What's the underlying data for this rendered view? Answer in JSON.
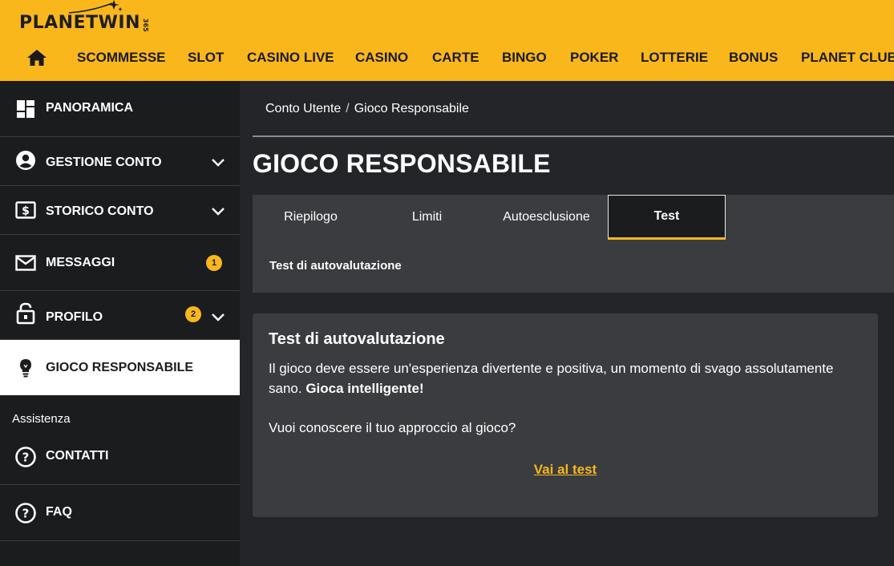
{
  "brand": {
    "name": "PLANETWIN",
    "suffix": "365",
    "accent_color": "#f9b71b"
  },
  "nav": {
    "home_icon": "home-icon",
    "items": [
      "SCOMMESSE",
      "SLOT",
      "CASINO LIVE",
      "CASINO",
      "CARTE",
      "BINGO",
      "POKER",
      "LOTTERIE",
      "BONUS",
      "PLANET CLUB"
    ]
  },
  "sidebar": {
    "items": [
      {
        "label": "PANORAMICA",
        "icon": "dashboard-icon"
      },
      {
        "label": "GESTIONE CONTO",
        "icon": "user-circle-icon"
      },
      {
        "label": "STORICO CONTO",
        "icon": "money-icon"
      },
      {
        "label": "MESSAGGI",
        "icon": "envelope-icon",
        "badge": "1"
      },
      {
        "label": "PROFILO",
        "icon": "lock-icon",
        "badge": "2"
      },
      {
        "label": "GIOCO RESPONSABILE",
        "icon": "lightbulb-icon"
      }
    ],
    "section_label": "Assistenza",
    "support_items": [
      {
        "label": "CONTATTI",
        "icon": "help-circle-icon"
      },
      {
        "label": "FAQ",
        "icon": "help-circle-icon"
      }
    ]
  },
  "breadcrumb": {
    "parent": "Conto Utente",
    "separator": "/",
    "current": "Gioco Responsabile"
  },
  "page": {
    "title": "GIOCO RESPONSABILE"
  },
  "tabs": {
    "items": [
      "Riepilogo",
      "Limiti",
      "Autoesclusione",
      "Test"
    ],
    "selected": "Test",
    "subtab": "Test di autovalutazione"
  },
  "card": {
    "title": "Test di autovalutazione",
    "text_normal": "Il gioco deve essere un'esperienza divertente e positiva, un momento di svago assolutamente sano. ",
    "text_bold": "Gioca intelligente!",
    "question": "Vuoi conoscere il tuo approccio al gioco?",
    "link": "Vai al test"
  }
}
